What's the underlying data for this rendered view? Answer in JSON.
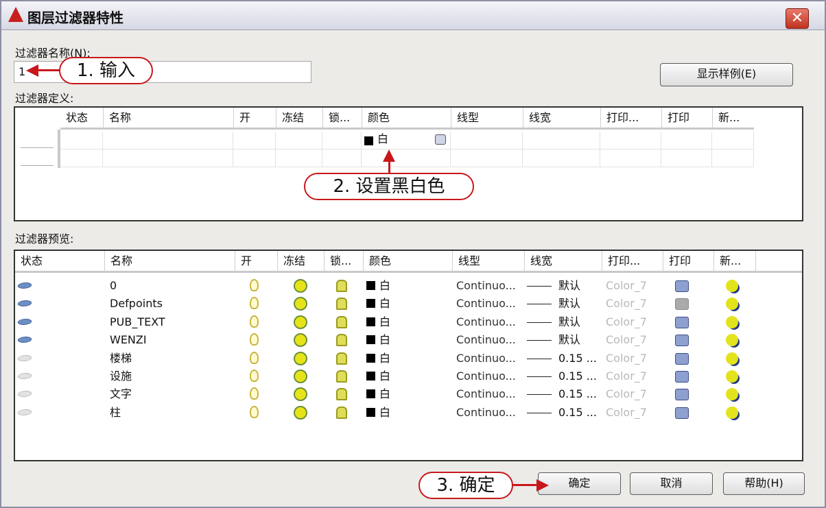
{
  "window": {
    "title": "图层过滤器特性",
    "close_label": "✕"
  },
  "filter_name": {
    "label": "过滤器名称(N):",
    "value": "1"
  },
  "show_example_button": "显示样例(E)",
  "definition": {
    "label": "过滤器定义:",
    "columns": [
      "状态",
      "名称",
      "开",
      "冻结",
      "锁...",
      "颜色",
      "线型",
      "线宽",
      "打印...",
      "打印",
      "新..."
    ],
    "row": {
      "color_name": "白"
    }
  },
  "preview": {
    "label": "过滤器预览:",
    "columns": [
      "状态",
      "名称",
      "开",
      "冻结",
      "锁...",
      "颜色",
      "线型",
      "线宽",
      "打印...",
      "打印",
      "新..."
    ],
    "rows": [
      {
        "name": "0",
        "color": "白",
        "linetype": "Continuo...",
        "lineweight": "默认",
        "plotstyle": "Color_7",
        "status": "in-use"
      },
      {
        "name": "Defpoints",
        "color": "白",
        "linetype": "Continuo...",
        "lineweight": "默认",
        "plotstyle": "Color_7",
        "status": "in-use",
        "no_plot": true
      },
      {
        "name": "PUB_TEXT",
        "color": "白",
        "linetype": "Continuo...",
        "lineweight": "默认",
        "plotstyle": "Color_7",
        "status": "in-use"
      },
      {
        "name": "WENZI",
        "color": "白",
        "linetype": "Continuo...",
        "lineweight": "默认",
        "plotstyle": "Color_7",
        "status": "in-use"
      },
      {
        "name": "楼梯",
        "color": "白",
        "linetype": "Continuo...",
        "lineweight": "0.15 ...",
        "plotstyle": "Color_7",
        "status": "unused"
      },
      {
        "name": "设施",
        "color": "白",
        "linetype": "Continuo...",
        "lineweight": "0.15 ...",
        "plotstyle": "Color_7",
        "status": "unused"
      },
      {
        "name": "文字",
        "color": "白",
        "linetype": "Continuo...",
        "lineweight": "0.15 ...",
        "plotstyle": "Color_7",
        "status": "unused"
      },
      {
        "name": "柱",
        "color": "白",
        "linetype": "Continuo...",
        "lineweight": "0.15 ...",
        "plotstyle": "Color_7",
        "status": "unused"
      }
    ]
  },
  "buttons": {
    "ok": "确定",
    "cancel": "取消",
    "help": "帮助(H)"
  },
  "callouts": {
    "step1": "1. 输入",
    "step2": "2. 设置黑白色",
    "step3": "3. 确定"
  },
  "colors": {
    "accent": "#c8171b"
  }
}
